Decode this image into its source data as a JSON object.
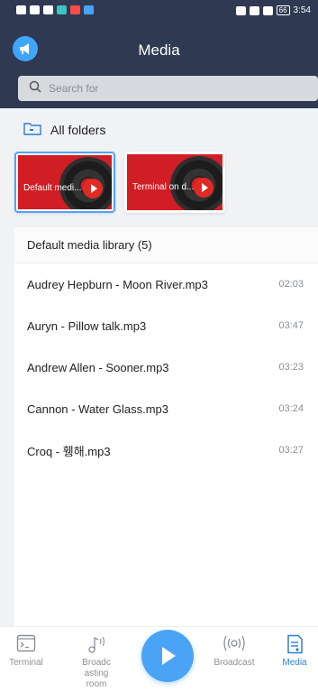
{
  "status_bar": {
    "time": "3:54",
    "battery": "66"
  },
  "header": {
    "title": "Media"
  },
  "search": {
    "placeholder": "Search for"
  },
  "folders_section": {
    "label": "All folders"
  },
  "folders": [
    {
      "label": "Default medi...",
      "selected": true
    },
    {
      "label": "Terminal on d...",
      "selected": false
    }
  ],
  "library": {
    "header": "Default media library (5)",
    "tracks": [
      {
        "name": "Audrey Hepburn - Moon River.mp3",
        "duration": "02:03"
      },
      {
        "name": "Auryn - Pillow talk.mp3",
        "duration": "03:47"
      },
      {
        "name": "Andrew Allen - Sooner.mp3",
        "duration": "03:23"
      },
      {
        "name": "Cannon - Water Glass.mp3",
        "duration": "03:24"
      },
      {
        "name": "Croq - 휑해.mp3",
        "duration": "03:27"
      }
    ]
  },
  "bottom_nav": {
    "terminal": "Terminal",
    "broadcasting_room": [
      "Broadc",
      "asting",
      "room"
    ],
    "broadcast": "Broadcast",
    "media": "Media",
    "active": "media"
  },
  "colors": {
    "header_bg": "#2f3a52",
    "accent": "#4aa3f5",
    "active_nav": "#2b7dd8"
  }
}
